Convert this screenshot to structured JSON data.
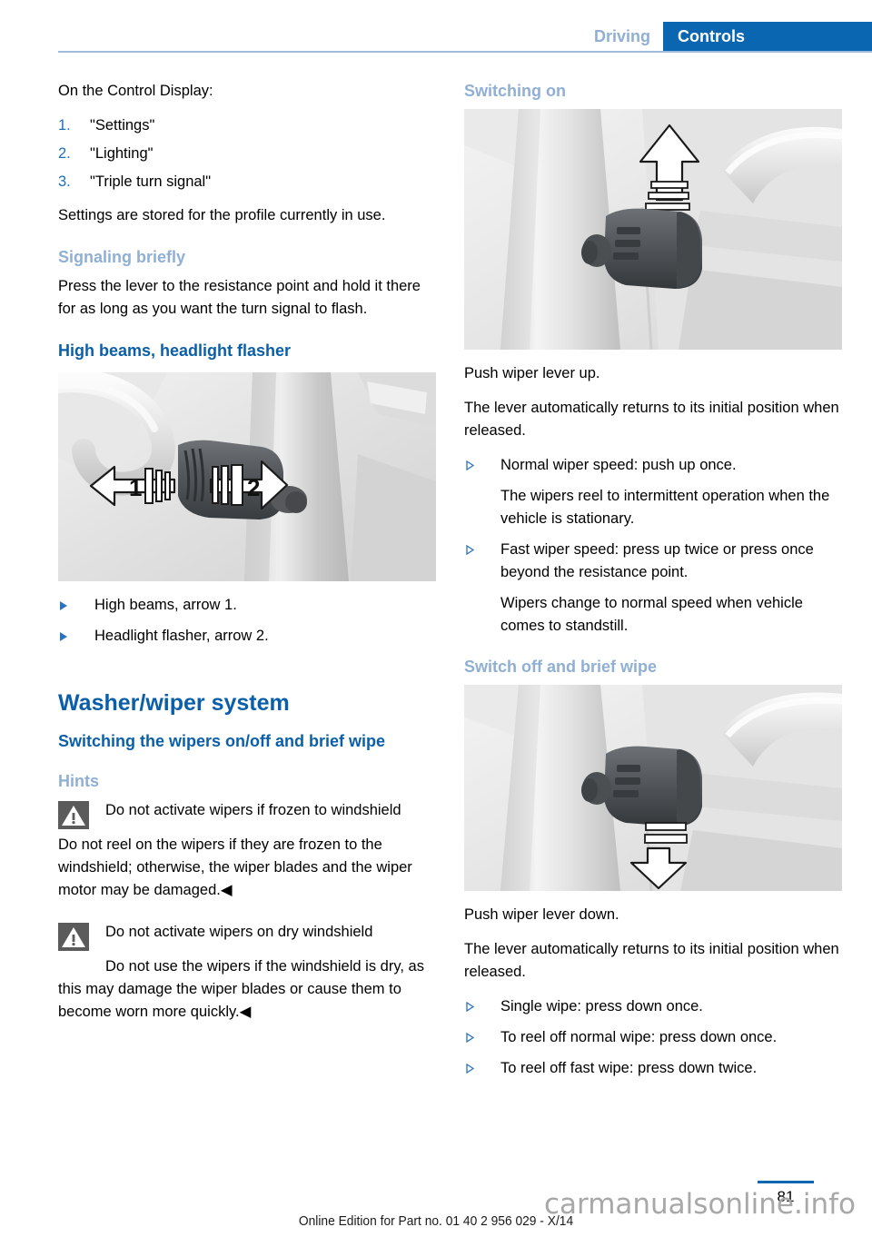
{
  "header": {
    "tab_inactive": "Driving",
    "tab_active": "Controls",
    "accent_blue": "#0A66B0",
    "muted_blue": "#8FAFD4"
  },
  "left_column": {
    "intro": "On the Control Display:",
    "numbered_items": [
      {
        "num": "1.",
        "label": "\"Settings\""
      },
      {
        "num": "2.",
        "label": "\"Lighting\""
      },
      {
        "num": "3.",
        "label": "\"Triple turn signal\""
      }
    ],
    "stored_note": "Settings are stored for the profile currently in use.",
    "signaling_heading": "Signaling briefly",
    "signaling_body": "Press the lever to the resistance point and hold it there for as long as you want the turn signal to flash.",
    "highbeam_heading": "High beams, headlight flasher",
    "highbeam_figure": {
      "name": "turn-signal-lever-illustration",
      "arrow_left_label": "1",
      "arrow_right_label": "2"
    },
    "highbeam_bullets": [
      "High beams, arrow 1.",
      "Headlight flasher, arrow 2."
    ],
    "washer_heading": "Washer/wiper system",
    "washer_sub": "Switching the wipers on/off and brief wipe",
    "hints_heading": "Hints",
    "warning_1": {
      "icon": "warning-triangle-icon",
      "title": "Do not activate wipers if frozen to windshield",
      "body": "Do not reel on the wipers if they are frozen to the windshield; otherwise, the wiper blades and the wiper motor may be damaged.",
      "endmark": "◀"
    },
    "warning_2": {
      "icon": "warning-triangle-icon",
      "title": "Do not activate wipers on dry windshield",
      "body": "Do not use the wipers if the windshield is dry, as this may damage the wiper blades or cause them to become worn more quickly.",
      "endmark": "◀"
    }
  },
  "right_column": {
    "switching_on_heading": "Switching on",
    "switching_on_figure": {
      "name": "wiper-lever-up-illustration",
      "arrow_direction": "up"
    },
    "push_up_text": "Push wiper lever up.",
    "returns_text_1": "The lever automatically returns to its initial position when released.",
    "on_bullets": [
      {
        "main": "Normal wiper speed: push up once.",
        "cont": "The wipers reel to intermittent operation when the vehicle is stationary."
      },
      {
        "main": "Fast wiper speed: press up twice or press once beyond the resistance point.",
        "cont": "Wipers change to normal speed when vehicle comes to standstill."
      }
    ],
    "switch_off_heading": "Switch off and brief wipe",
    "switch_off_figure": {
      "name": "wiper-lever-down-illustration",
      "arrow_direction": "down"
    },
    "push_down_text": "Push wiper lever down.",
    "returns_text_2": "The lever automatically returns to its initial position when released.",
    "off_bullets": [
      "Single wipe: press down once.",
      "To reel off normal wipe: press down once.",
      "To reel off fast wipe: press down twice."
    ]
  },
  "footer": {
    "note": "Online Edition for Part no. 01 40 2 956 029 - X/14",
    "page_number": "81",
    "watermark": "carmanualsonline.info"
  }
}
